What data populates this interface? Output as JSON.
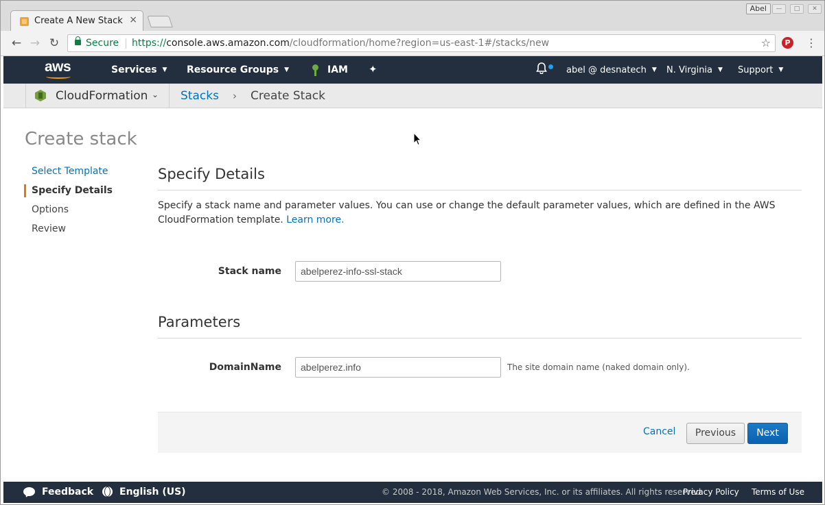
{
  "browser": {
    "tab_title": "Create A New Stack",
    "tab_close": "×",
    "profile_name": "Abel",
    "secure_label": "Secure",
    "url_scheme": "https://",
    "url_host": "console.aws.amazon.com",
    "url_path": "/cloudformation/home?region=us-east-1#/stacks/new",
    "back_glyph": "←",
    "forward_glyph": "→",
    "reload_glyph": "↻",
    "star_glyph": "☆",
    "menu_glyph": "⋮",
    "pinterest_glyph": "P"
  },
  "aws_nav": {
    "logo_text": "aws",
    "services": "Services",
    "resource_groups": "Resource Groups",
    "iam": "IAM",
    "pin_glyph": "✦",
    "bell_glyph": "🔔",
    "account": "abel @ desnatech",
    "region": "N. Virginia",
    "support": "Support",
    "caret": "▼"
  },
  "service_bar": {
    "service_name": "CloudFormation",
    "service_caret": "⌄",
    "crumb_stacks": "Stacks",
    "crumb_sep": "›",
    "crumb_current": "Create Stack"
  },
  "page": {
    "title": "Create stack",
    "steps": [
      {
        "label": "Select Template"
      },
      {
        "label": "Specify Details"
      },
      {
        "label": "Options"
      },
      {
        "label": "Review"
      }
    ],
    "section_title": "Specify Details",
    "description": "Specify a stack name and parameter values. You can use or change the default parameter values, which are defined in the AWS CloudFormation template.",
    "learn_more": "Learn more.",
    "stack_name_label": "Stack name",
    "stack_name_value": "abelperez-info-ssl-stack",
    "parameters_title": "Parameters",
    "domain_label": "DomainName",
    "domain_value": "abelperez.info",
    "domain_hint": "The site domain name (naked domain only).",
    "cancel": "Cancel",
    "previous": "Previous",
    "next": "Next"
  },
  "footer": {
    "feedback": "Feedback",
    "language": "English (US)",
    "copyright": "© 2008 - 2018, Amazon Web Services, Inc. or its affiliates. All rights reserved.",
    "privacy": "Privacy Policy",
    "terms": "Terms of Use"
  },
  "colors": {
    "aws_nav_bg": "#232f3e",
    "link": "#0073bb",
    "primary_button": "#0a62b0",
    "active_step_accent": "#ec7211",
    "secure_green": "#0b8043"
  }
}
